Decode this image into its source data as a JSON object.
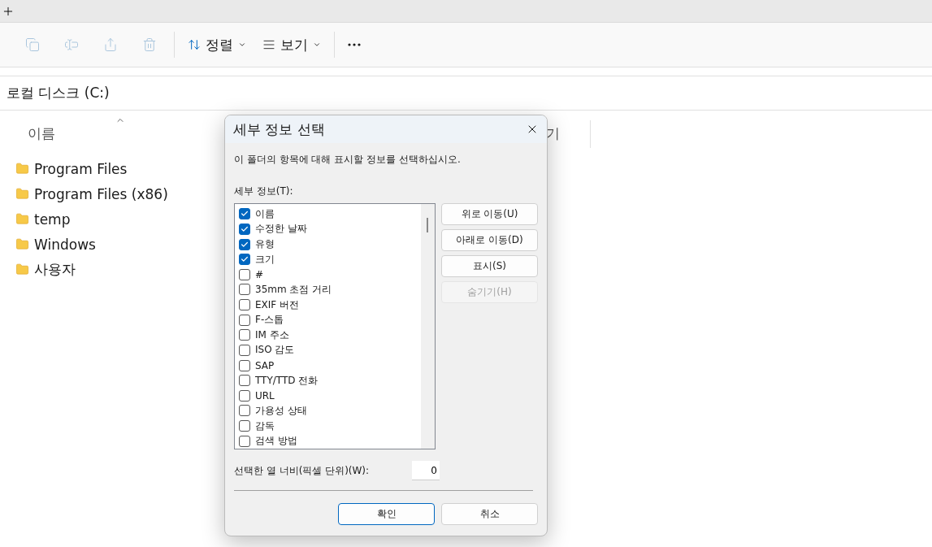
{
  "toolbar": {
    "actions": [
      {
        "kind": "copy",
        "disabled": true
      },
      {
        "kind": "rename",
        "disabled": true
      },
      {
        "kind": "share",
        "disabled": true
      },
      {
        "kind": "delete",
        "disabled": true
      }
    ],
    "sort": {
      "label": "정렬"
    },
    "view": {
      "label": "보기"
    }
  },
  "address": "로컬 디스크 (C:)",
  "columns": [
    {
      "label": "이름",
      "sorted": true
    },
    {
      "label": "기",
      "sorted": false
    }
  ],
  "files": [
    "Program Files",
    "Program Files (x86)",
    "temp",
    "Windows",
    "사용자"
  ],
  "dialog": {
    "title": "세부 정보 선택",
    "instruction": "이 폴더의 항목에 대해 표시할 정보를 선택하십시오.",
    "list_label": "세부 정보(T):",
    "items": [
      {
        "label": "이름",
        "checked": true
      },
      {
        "label": "수정한 날짜",
        "checked": true
      },
      {
        "label": "유형",
        "checked": true
      },
      {
        "label": "크기",
        "checked": true
      },
      {
        "label": "#",
        "checked": false
      },
      {
        "label": "35mm 초점 거리",
        "checked": false
      },
      {
        "label": "EXIF 버전",
        "checked": false
      },
      {
        "label": "F-스톱",
        "checked": false
      },
      {
        "label": "IM 주소",
        "checked": false
      },
      {
        "label": "ISO 감도",
        "checked": false
      },
      {
        "label": "SAP",
        "checked": false
      },
      {
        "label": "TTY/TTD 전화",
        "checked": false
      },
      {
        "label": "URL",
        "checked": false
      },
      {
        "label": "가용성 상태",
        "checked": false
      },
      {
        "label": "감독",
        "checked": false
      },
      {
        "label": "검색 방법",
        "checked": false
      }
    ],
    "side_buttons": [
      {
        "label": "위로 이동(U)",
        "disabled": false
      },
      {
        "label": "아래로 이동(D)",
        "disabled": false
      },
      {
        "label": "표시(S)",
        "disabled": false
      },
      {
        "label": "숨기기(H)",
        "disabled": true
      }
    ],
    "width_label": "선택한 열 너비(픽셀 단위)(W):",
    "width_value": "0",
    "ok": "확인",
    "cancel": "취소"
  }
}
